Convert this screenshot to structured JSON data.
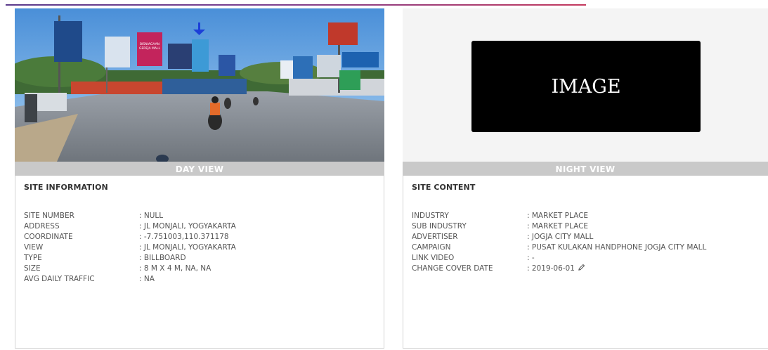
{
  "day_panel": {
    "caption": "DAY VIEW",
    "info_title": "SITE INFORMATION",
    "rows": [
      {
        "label": "SITE NUMBER",
        "value": ": NULL"
      },
      {
        "label": "ADDRESS",
        "value": ": JL MONJALI, YOGYAKARTA"
      },
      {
        "label": "COORDINATE",
        "value": ": -7.751003,110.371178"
      },
      {
        "label": "VIEW",
        "value": ": JL MONJALI, YOGYAKARTA"
      },
      {
        "label": "TYPE",
        "value": ": BILLBOARD"
      },
      {
        "label": "SIZE",
        "value": ": 8 M X 4 M, NA, NA"
      },
      {
        "label": "AVG DAILY TRAFFIC",
        "value": ": NA"
      }
    ]
  },
  "night_panel": {
    "caption": "NIGHT VIEW",
    "placeholder_text": "IMAGE",
    "info_title": "SITE CONTENT",
    "rows": [
      {
        "label": "INDUSTRY",
        "value": ": MARKET PLACE"
      },
      {
        "label": "SUB INDUSTRY",
        "value": ": MARKET PLACE"
      },
      {
        "label": "ADVERTISER",
        "value": ": JOGJA CITY MALL"
      },
      {
        "label": "CAMPAIGN",
        "value": ": PUSAT KULAKAN HANDPHONE JOGJA CITY MALL"
      },
      {
        "label": "LINK VIDEO",
        "value": ": -"
      },
      {
        "label": "CHANGE COVER DATE",
        "value": ": 2019-06-01"
      }
    ]
  },
  "billboard_photo": {
    "billboard_text": "BISNIAGAAN GEREJA MALL"
  },
  "icons": {
    "edit": "pencil-icon",
    "marker": "arrow-down-icon"
  }
}
